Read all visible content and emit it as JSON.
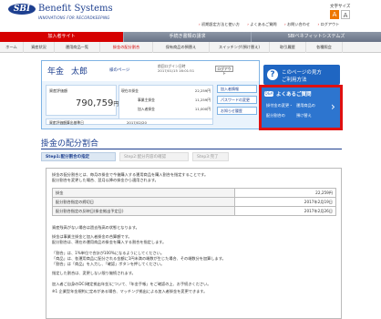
{
  "brand": {
    "mark": "SBI",
    "name": "Benefit Systems",
    "tagline": "INNOVATIONS FOR RECORDKEEPING"
  },
  "font_size": {
    "label": "文字サイズ",
    "large": "A",
    "small": "A"
  },
  "top_links": [
    "初期設定方法と使い方",
    "よくあるご質問",
    "お問い合わせ",
    "ログアウト"
  ],
  "main_nav": [
    "加入者サイト",
    "手続き書類の請求",
    "SBIベネフィットシステムズ"
  ],
  "sub_nav": [
    "ホーム",
    "資産状況",
    "運用商品一覧",
    "掛金の配分割合",
    "保有商品の預替え",
    "スイッチング(預け替え)",
    "取引履歴",
    "各種照会"
  ],
  "account": {
    "label": "年金",
    "name": "太郎",
    "page": "様のページ",
    "login_line1": "前回ログイン日時",
    "login_line2": "2017/01/15 16:01:51",
    "logout": "ログアウト",
    "balance_label": "資産評価額",
    "balance_value": "790,759",
    "balance_unit": "円",
    "details": [
      {
        "k": "現在の掛金",
        "v": "22,259円"
      },
      {
        "k": "事業主掛金",
        "v": "11,259円"
      },
      {
        "k": "加入者掛金",
        "v": "11,000円"
      }
    ],
    "side_buttons": [
      "加入者情報",
      "パスワードの変更",
      "お知らせ履歴"
    ],
    "footer_key": "資産評価額算出基準日",
    "footer_value": "2017/02/20"
  },
  "help": {
    "icon": "?",
    "line1": "このページの見方",
    "line2": "ご利用方法"
  },
  "faq": {
    "icon": "Q&A",
    "title": "よくあるご質問",
    "items": [
      "掛付金の変更・",
      "運用商品の",
      "配分割合の",
      "預け替え"
    ]
  },
  "section_title": "掛金の配分割合",
  "steps": [
    "Step1:配分割合の指定",
    "Step2:配分内容の確認",
    "Step3:完了"
  ],
  "intro": [
    "掛金の配分割合とは、毎月の掛金で今後購入する運用商品を購入割合を指定することです。",
    "配分割合を変更した場合、翌月以降の掛金から適用されます。"
  ],
  "table": [
    {
      "k": "掛金",
      "v": "22,259円"
    },
    {
      "k": "配分割合指定の締切日",
      "v": "2017年2月19日"
    },
    {
      "k": "配分割合指定の反映日(掛金拠出予定日)",
      "v": "2017年2月26日"
    }
  ],
  "notes": [
    "資産残高がない場合は過去残高の状態となります。",
    "掛金は事業主掛金と加入者掛金の合算額です。",
    "配分割合は、現在の運用商品の掛金を購入する割合を指定します。",
    "「割合」は、1%単位で合計が100%になるようにしてください。",
    "「商品」は、各運用商品に配分される金額に1円未満の端数が生じた場合、その端数分を加算します。",
    "「割合」は「商品」を入力し、「確認」ボタンを押してください。",
    "指定した割合は、変更しない限り継続されます。",
    "加入者ご自身のDC(確定拠出年金)について、「年金手帳」をご確認の上、お手続きください。",
    "※1 企業型年金規約に定めがある場合、マッチング拠出による加入者掛金を変更できます。"
  ]
}
